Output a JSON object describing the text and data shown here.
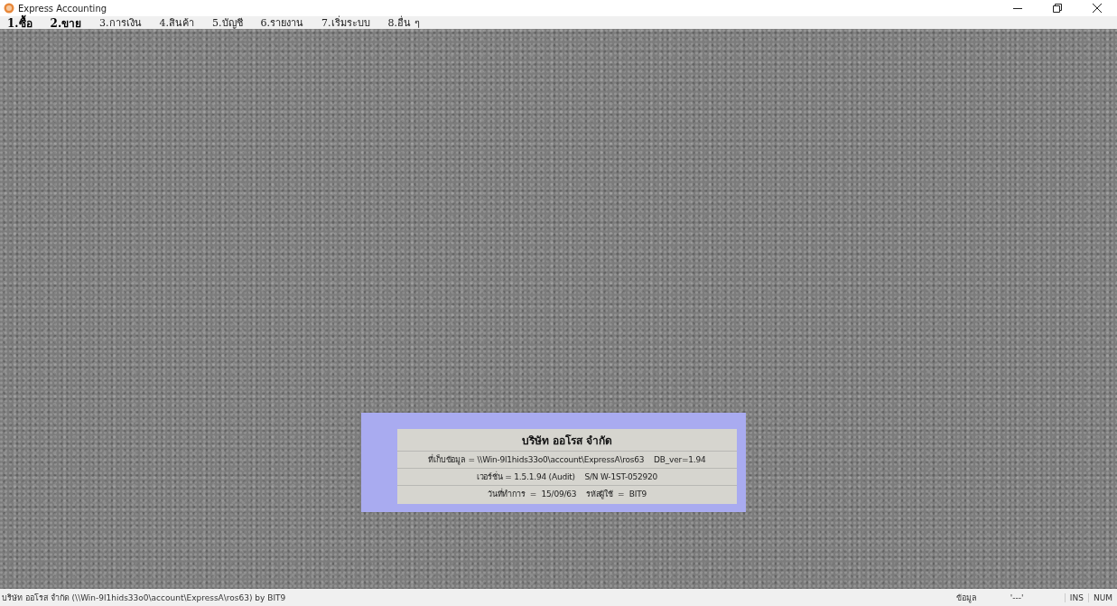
{
  "window": {
    "title": "Express Accounting"
  },
  "menu": [
    {
      "label": "1.ซื้อ",
      "emphasized": true
    },
    {
      "label": "2.ขาย",
      "emphasized": true
    },
    {
      "label": "3.การเงิน",
      "emphasized": false
    },
    {
      "label": "4.สินค้า",
      "emphasized": false
    },
    {
      "label": "5.บัญชี",
      "emphasized": false
    },
    {
      "label": "6.รายงาน",
      "emphasized": false
    },
    {
      "label": "7.เริ่มระบบ",
      "emphasized": false
    },
    {
      "label": "8.อื่น ๆ",
      "emphasized": false
    }
  ],
  "info_panel": {
    "company": "บริษัท ออโรส จำกัด",
    "lines": [
      "ที่เก็บข้อมูล = \\\\Win-9l1hids33o0\\account\\ExpressA\\ros63    DB_ver=1.94",
      "เวอร์ชั่น = 1.5.1.94 (Audit)    S/N W-1ST-052920",
      "วันที่ทำการ  =  15/09/63    รหัสผู้ใช้  =  BIT9"
    ]
  },
  "status_bar": [
    "บริษัท ออโรส จำกัด (\\\\Win-9l1hids33o0\\account\\ExpressA\\ros63) by BIT9",
    "ข้อมูล",
    "'---'",
    "INS",
    "NUM"
  ]
}
